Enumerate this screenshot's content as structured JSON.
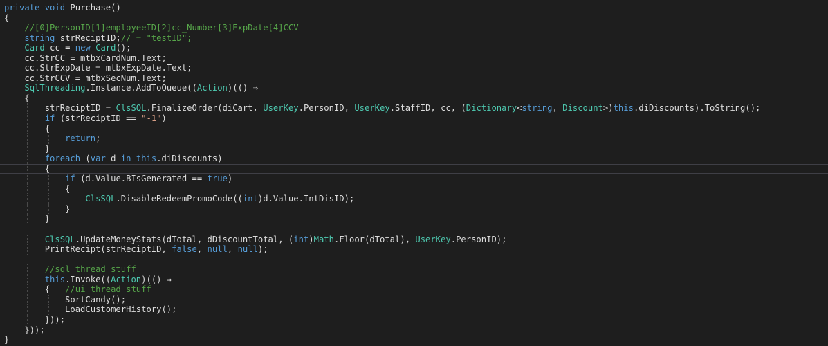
{
  "colors": {
    "background": "#1e1e1e",
    "keyword": "#569cd6",
    "type": "#4ec9b0",
    "string": "#d69d85",
    "comment": "#57a64a",
    "plain": "#dcdcdc",
    "current_line_border": "#3f3f46"
  },
  "editor": {
    "current_line_index": 16,
    "lines": [
      [
        {
          "t": "private",
          "c": "kw"
        },
        {
          "t": " "
        },
        {
          "t": "void",
          "c": "kw"
        },
        {
          "t": " Purchase()"
        }
      ],
      [
        {
          "t": "{"
        }
      ],
      [
        {
          "t": "    "
        },
        {
          "t": "//[0]PersonID[1]employeeID[2]cc_Number[3]ExpDate[4]CCV",
          "c": "cmt"
        }
      ],
      [
        {
          "t": "    "
        },
        {
          "t": "string",
          "c": "kw"
        },
        {
          "t": " strReciptID;"
        },
        {
          "t": "// = \"testID\";",
          "c": "cmt"
        }
      ],
      [
        {
          "t": "    "
        },
        {
          "t": "Card",
          "c": "type"
        },
        {
          "t": " cc = "
        },
        {
          "t": "new",
          "c": "kw"
        },
        {
          "t": " "
        },
        {
          "t": "Card",
          "c": "type"
        },
        {
          "t": "();"
        }
      ],
      [
        {
          "t": "    cc.StrCC = mtbxCardNum.Text;"
        }
      ],
      [
        {
          "t": "    cc.StrExpDate = mtbxExpDate.Text;"
        }
      ],
      [
        {
          "t": "    cc.StrCCV = mtbxSecNum.Text;"
        }
      ],
      [
        {
          "t": "    "
        },
        {
          "t": "SqlThreading",
          "c": "type"
        },
        {
          "t": ".Instance.AddToQueue(("
        },
        {
          "t": "Action",
          "c": "type"
        },
        {
          "t": ")(() ⇒"
        }
      ],
      [
        {
          "t": "    {"
        }
      ],
      [
        {
          "t": "        strReciptID = "
        },
        {
          "t": "ClsSQL",
          "c": "type"
        },
        {
          "t": ".FinalizeOrder(diCart, "
        },
        {
          "t": "UserKey",
          "c": "type"
        },
        {
          "t": ".PersonID, "
        },
        {
          "t": "UserKey",
          "c": "type"
        },
        {
          "t": ".StaffID, cc, ("
        },
        {
          "t": "Dictionary",
          "c": "type"
        },
        {
          "t": "<"
        },
        {
          "t": "string",
          "c": "kw"
        },
        {
          "t": ", "
        },
        {
          "t": "Discount",
          "c": "type"
        },
        {
          "t": ">)"
        },
        {
          "t": "this",
          "c": "kw"
        },
        {
          "t": ".diDiscounts).ToString();"
        }
      ],
      [
        {
          "t": "        "
        },
        {
          "t": "if",
          "c": "kw"
        },
        {
          "t": " (strReciptID == "
        },
        {
          "t": "\"-1\"",
          "c": "str"
        },
        {
          "t": ")"
        }
      ],
      [
        {
          "t": "        {"
        }
      ],
      [
        {
          "t": "            "
        },
        {
          "t": "return",
          "c": "kw"
        },
        {
          "t": ";"
        }
      ],
      [
        {
          "t": "        }"
        }
      ],
      [
        {
          "t": "        "
        },
        {
          "t": "foreach",
          "c": "kw"
        },
        {
          "t": " ("
        },
        {
          "t": "var",
          "c": "kw"
        },
        {
          "t": " d "
        },
        {
          "t": "in",
          "c": "kw"
        },
        {
          "t": " "
        },
        {
          "t": "this",
          "c": "kw"
        },
        {
          "t": ".diDiscounts)"
        }
      ],
      [
        {
          "t": "        {"
        }
      ],
      [
        {
          "t": "            "
        },
        {
          "t": "if",
          "c": "kw"
        },
        {
          "t": " (d.Value.BIsGenerated == "
        },
        {
          "t": "true",
          "c": "kw"
        },
        {
          "t": ")"
        }
      ],
      [
        {
          "t": "            {"
        }
      ],
      [
        {
          "t": "                "
        },
        {
          "t": "ClsSQL",
          "c": "type"
        },
        {
          "t": ".DisableRedeemPromoCode(("
        },
        {
          "t": "int",
          "c": "kw"
        },
        {
          "t": ")d.Value.IntDisID);"
        }
      ],
      [
        {
          "t": "            }"
        }
      ],
      [
        {
          "t": "        }"
        }
      ],
      [
        {
          "t": ""
        }
      ],
      [
        {
          "t": "        "
        },
        {
          "t": "ClsSQL",
          "c": "type"
        },
        {
          "t": ".UpdateMoneyStats(dTotal, dDiscountTotal, ("
        },
        {
          "t": "int",
          "c": "kw"
        },
        {
          "t": ")"
        },
        {
          "t": "Math",
          "c": "type"
        },
        {
          "t": ".Floor(dTotal), "
        },
        {
          "t": "UserKey",
          "c": "type"
        },
        {
          "t": ".PersonID);"
        }
      ],
      [
        {
          "t": "        PrintRecipt(strReciptID, "
        },
        {
          "t": "false",
          "c": "kw"
        },
        {
          "t": ", "
        },
        {
          "t": "null",
          "c": "kw"
        },
        {
          "t": ", "
        },
        {
          "t": "null",
          "c": "kw"
        },
        {
          "t": ");"
        }
      ],
      [
        {
          "t": ""
        }
      ],
      [
        {
          "t": "        "
        },
        {
          "t": "//sql thread stuff",
          "c": "cmt"
        }
      ],
      [
        {
          "t": "        "
        },
        {
          "t": "this",
          "c": "kw"
        },
        {
          "t": ".Invoke(("
        },
        {
          "t": "Action",
          "c": "type"
        },
        {
          "t": ")(() ⇒"
        }
      ],
      [
        {
          "t": "        {   "
        },
        {
          "t": "//ui thread stuff",
          "c": "cmt"
        }
      ],
      [
        {
          "t": "            SortCandy();"
        }
      ],
      [
        {
          "t": "            LoadCustomerHistory();"
        }
      ],
      [
        {
          "t": "        }));"
        }
      ],
      [
        {
          "t": "    }));"
        }
      ],
      [
        {
          "t": "}"
        }
      ]
    ]
  }
}
